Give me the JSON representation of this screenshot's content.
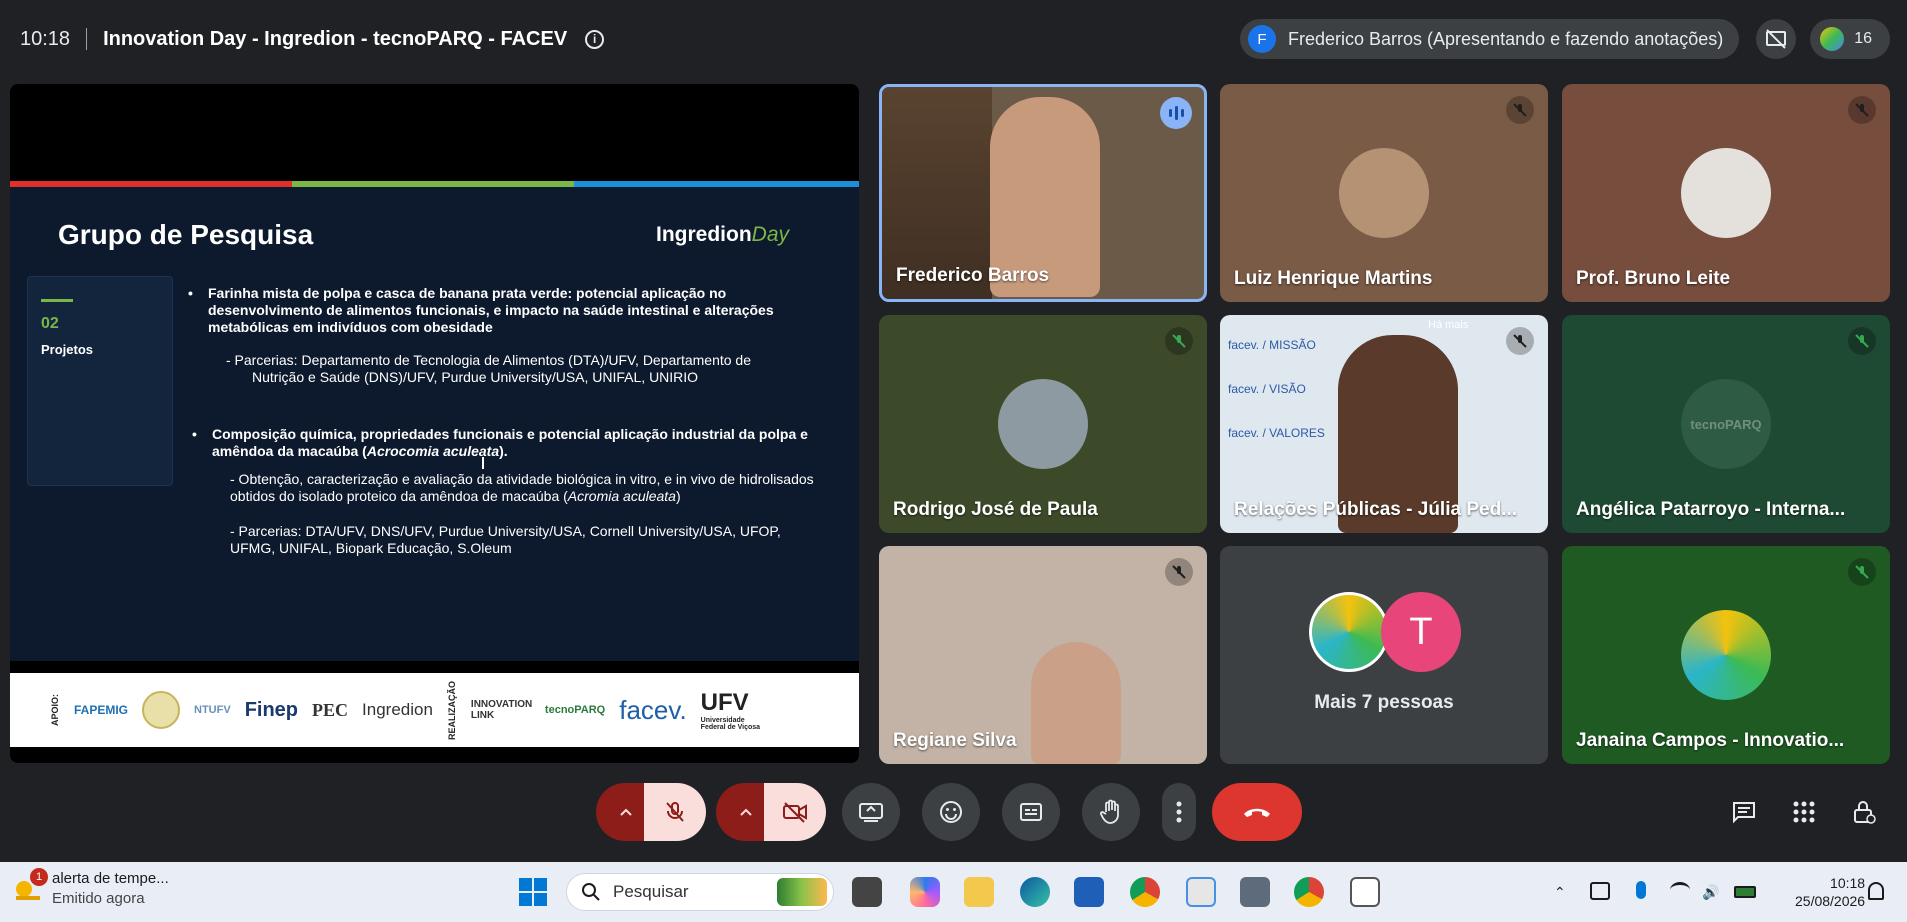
{
  "topbar": {
    "time": "10:18",
    "meeting_title": "Innovation Day - Ingredion - tecnoPARQ - FACEV",
    "presenter_initial": "F",
    "presenter_label": "Frederico Barros (Apresentando e fazendo anotações)",
    "participant_count": "16"
  },
  "slide": {
    "title": "Grupo de Pesquisa",
    "brand_main": "Ingredion",
    "brand_suffix": "Day",
    "section_number": "02",
    "section_label": "Projetos",
    "project1_title": "Farinha mista de polpa e casca de banana prata verde: potencial aplicação no desenvolvimento de alimentos funcionais, e impacto na saúde intestinal e alterações metabólicas em indivíduos com obesidade",
    "project1_partners_line1": "- Parcerias: Departamento de Tecnologia de Alimentos (DTA)/UFV, Departamento de",
    "project1_partners_line2": "Nutrição e Saúde (DNS)/UFV, Purdue University/USA, UNIFAL, UNIRIO",
    "project2_title_a": "Composição química, propriedades funcionais e potencial aplicação industrial da polpa e amêndoa da macaúba (",
    "project2_title_italic": "Acrocomia aculeata",
    "project2_title_b": ").",
    "project2_desc_a": "-  Obtenção, caracterização e avaliação da atividade biológica in vitro, e in vivo de hidrolisados obtidos do isolado proteico da amêndoa de macaúba (",
    "project2_desc_italic": "Acromia aculeata",
    "project2_desc_b": ")",
    "project2_partners": "- Parcerias: DTA/UFV, DNS/UFV, Purdue University/USA, Cornell University/USA, UFOP, UFMG, UNIFAL, Biopark Educação, S.Oleum",
    "logos": {
      "apoio": "APOIO:",
      "fapemig": "FAPEMIG",
      "ntufv": "NTUFV",
      "finep": "Finep",
      "pec": "PEC",
      "ingredion": "Ingredion",
      "realizacao": "REALIZAÇÃO",
      "innovation": "INNOVATION LINK",
      "tecnoparq": "tecnoPARQ",
      "facev": "facev.",
      "ufv": "UFV",
      "ufv_sub": "Universidade Federal de Viçosa"
    }
  },
  "participants": [
    {
      "name": "Frederico Barros"
    },
    {
      "name": "Luiz Henrique Martins"
    },
    {
      "name": "Prof. Bruno Leite"
    },
    {
      "name": "Rodrigo José de Paula"
    },
    {
      "name": "Relações Públicas - Júlia Ped..."
    },
    {
      "name": "Angélica Patarroyo - Interna..."
    },
    {
      "name": "Regiane Silva"
    },
    {
      "name": "Mais 7 pessoas",
      "avatar_letter": "T"
    },
    {
      "name": "Janaina Campos - Innovatio..."
    }
  ],
  "tile_text": {
    "facev_missao": "facev. / MISSÃO",
    "facev_visao": "facev. / VISÃO",
    "facev_valores": "facev. / VALORES",
    "ha_mais": "Há mais",
    "tecnoparq": "tecnoPARQ"
  },
  "taskbar": {
    "notif_badge": "1",
    "notif_title": "alerta de tempe...",
    "notif_sub": "Emitido agora",
    "search_placeholder": "Pesquisar",
    "clock_time": "10:18",
    "clock_date": "25/08/2026"
  },
  "colors": {
    "end_call": "#dc362e",
    "mic_muted_bg": "#f9dedc",
    "accent_green": "#7ab648"
  }
}
